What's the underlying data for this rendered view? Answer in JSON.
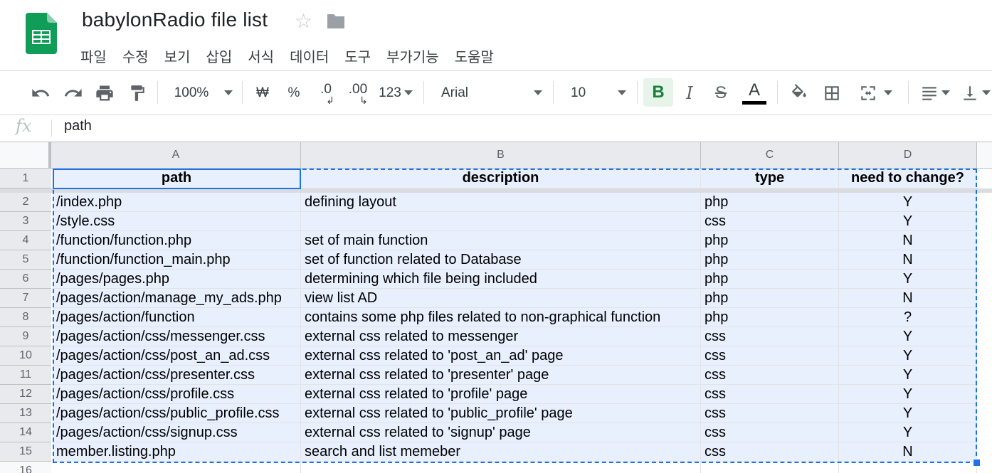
{
  "app": {
    "title": "babylonRadio file list",
    "menu": [
      "파일",
      "수정",
      "보기",
      "삽입",
      "서식",
      "데이터",
      "도구",
      "부가기능",
      "도움말"
    ]
  },
  "toolbar": {
    "zoom": "100%",
    "currency": "₩",
    "percent": "%",
    "decrease_decimal": ".0",
    "increase_decimal": ".00",
    "number_format": "123",
    "font": "Arial",
    "font_size": "10",
    "bold": "B",
    "italic": "I",
    "strike": "S",
    "text_color": "A",
    "icons": [
      "undo-icon",
      "redo-icon",
      "print-icon",
      "paint-format-icon",
      "fill-color-icon",
      "borders-icon",
      "merge-cells-icon",
      "align-left-icon",
      "vertical-align-icon"
    ]
  },
  "formula_bar": {
    "fx_label": "fx",
    "value": "path"
  },
  "sheet": {
    "columns": [
      "A",
      "B",
      "C",
      "D"
    ],
    "header_row": {
      "row": "1",
      "cells": [
        "path",
        "description",
        "type",
        "need to change?"
      ]
    },
    "rows": [
      {
        "row": "2",
        "cells": [
          "/index.php",
          "defining layout",
          "php",
          "Y"
        ]
      },
      {
        "row": "3",
        "cells": [
          "/style.css",
          "",
          "css",
          "Y"
        ]
      },
      {
        "row": "4",
        "cells": [
          "/function/function.php",
          "set of main function",
          "php",
          "N"
        ]
      },
      {
        "row": "5",
        "cells": [
          "/function/function_main.php",
          "set of function related to Database",
          "php",
          "N"
        ]
      },
      {
        "row": "6",
        "cells": [
          "/pages/pages.php",
          "determining which file being included",
          "php",
          "Y"
        ]
      },
      {
        "row": "7",
        "cells": [
          "/pages/action/manage_my_ads.php",
          "view list AD",
          "php",
          "N"
        ]
      },
      {
        "row": "8",
        "cells": [
          "/pages/action/function",
          "contains some php files related to non-graphical function",
          "php",
          "?"
        ]
      },
      {
        "row": "9",
        "cells": [
          "/pages/action/css/messenger.css",
          "external css related to messenger",
          "css",
          "Y"
        ]
      },
      {
        "row": "10",
        "cells": [
          "/pages/action/css/post_an_ad.css",
          "external css related to 'post_an_ad' page",
          "css",
          "Y"
        ]
      },
      {
        "row": "11",
        "cells": [
          "/pages/action/css/presenter.css",
          "external css related to 'presenter' page",
          "css",
          "Y"
        ]
      },
      {
        "row": "12",
        "cells": [
          "/pages/action/css/profile.css",
          "external css related to 'profile' page",
          "css",
          "Y"
        ]
      },
      {
        "row": "13",
        "cells": [
          "/pages/action/css/public_profile.css",
          "external css related to 'public_profile' page",
          "css",
          "Y"
        ]
      },
      {
        "row": "14",
        "cells": [
          "/pages/action/css/signup.css",
          "external css related to 'signup' page",
          "css",
          "Y"
        ]
      },
      {
        "row": "15",
        "cells": [
          "member.listing.php",
          "search and list memeber",
          "css",
          "N"
        ]
      }
    ],
    "partial_row": "16"
  },
  "colors": {
    "selection": "#e8f0fe",
    "accent": "#1a73e8",
    "sheets_green": "#0f9d58"
  }
}
